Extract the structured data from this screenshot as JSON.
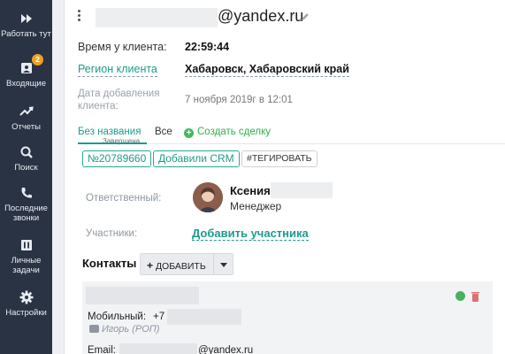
{
  "sidebar": {
    "items": [
      {
        "label": "Работать тут",
        "icon": "fast-forward-icon"
      },
      {
        "label": "Входящие",
        "icon": "inbox-icon",
        "badge": "2"
      },
      {
        "label": "Отчеты",
        "icon": "trend-chart-icon"
      },
      {
        "label": "Поиск",
        "icon": "search-icon"
      },
      {
        "label": "Последние звонки",
        "icon": "phone-icon"
      },
      {
        "label": "Личные задачи",
        "icon": "tasks-icon"
      },
      {
        "label": "Настройки",
        "icon": "gear-icon"
      }
    ]
  },
  "header": {
    "email_suffix": "@yandex.ru"
  },
  "client": {
    "time_label": "Время у клиента:",
    "time_value": "22:59:44",
    "region_label": "Регион клиента",
    "region_value": "Хабаровск, Хабаровский край",
    "date_added_label": "Дата добавления клиента:",
    "date_added_value": "7 ноября 2019г в 12:01"
  },
  "tabs": {
    "active": "Без названия",
    "active_status": "Завершена",
    "all": "Все",
    "create_deal": "Создать сделку"
  },
  "tags": {
    "deal_number": "№20789660",
    "crm": "Добавили CRM",
    "tag_action": "#ТЕГИРОВАТЬ"
  },
  "responsible": {
    "label": "Ответственный:",
    "name": "Ксения",
    "role": "Менеджер"
  },
  "participants": {
    "label": "Участники:",
    "add_link": "Добавить участника"
  },
  "contacts": {
    "title": "Контакты",
    "add_button": "ДОБАВИТЬ",
    "card": {
      "mobile_label": "Мобильный:",
      "mobile_prefix": "+7",
      "note": "Игорь (РОП)",
      "email_label": "Email:",
      "email_suffix": "@yandex.ru"
    }
  },
  "colors": {
    "sidebar_bg": "#2a3344",
    "accent_teal": "#1c9c8c",
    "accent_green": "#43b85c",
    "badge_orange": "#f0a021"
  }
}
